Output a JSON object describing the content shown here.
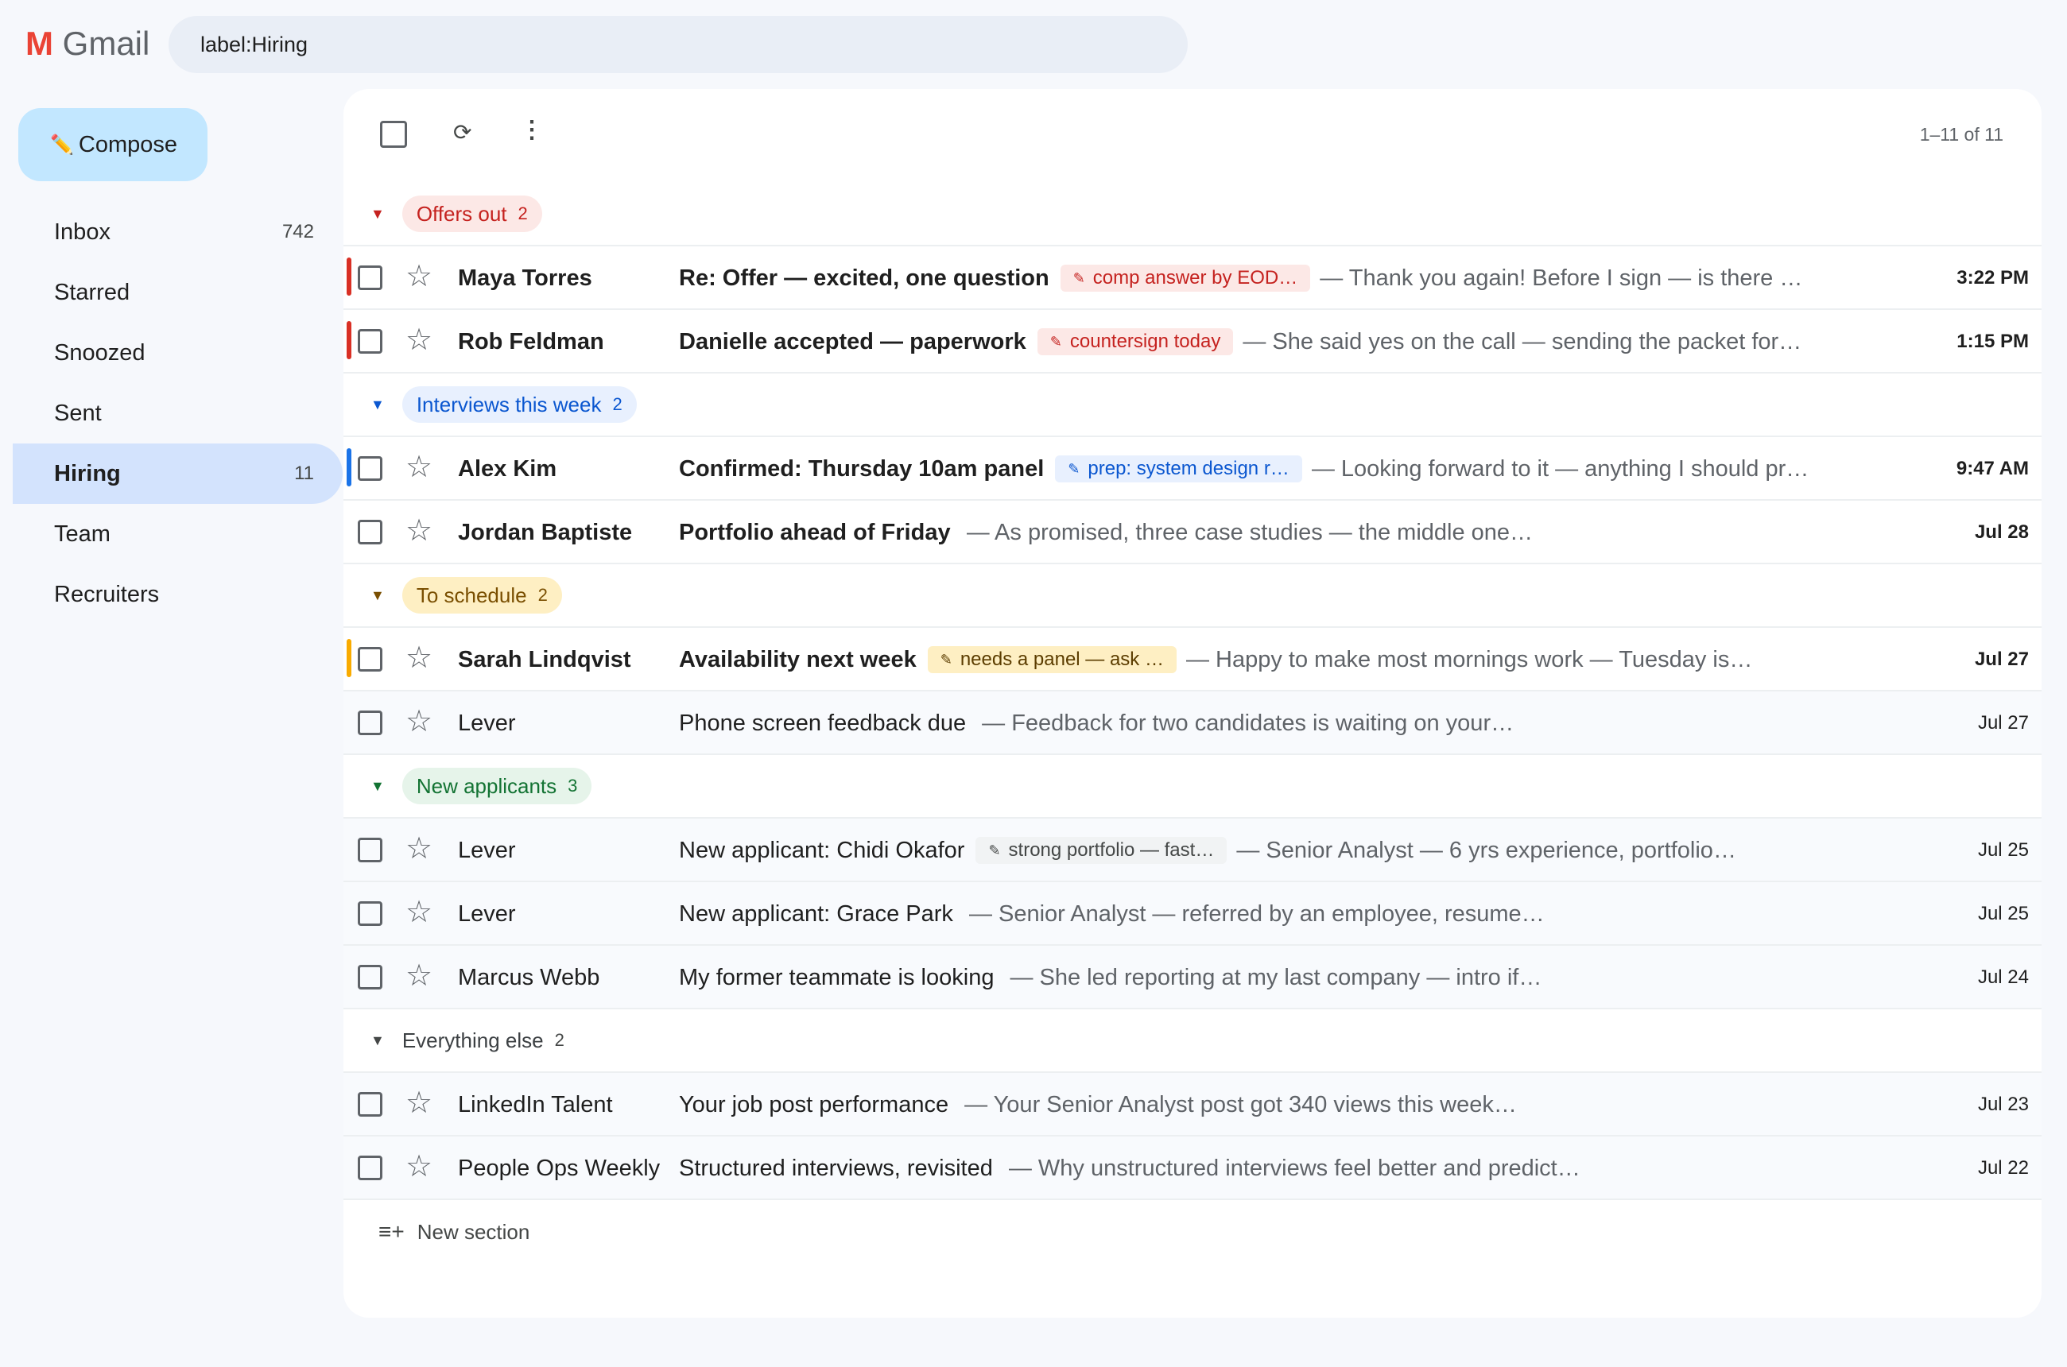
{
  "app": {
    "logo_m": "M",
    "logo_text": "Gmail"
  },
  "search": {
    "query": "label:Hiring"
  },
  "compose": {
    "icon": "✏️",
    "label": "Compose"
  },
  "nav": {
    "items": [
      {
        "label": "Inbox",
        "count": "742"
      },
      {
        "label": "Starred",
        "count": ""
      },
      {
        "label": "Snoozed",
        "count": ""
      },
      {
        "label": "Sent",
        "count": ""
      },
      {
        "label": "Hiring",
        "count": "11"
      },
      {
        "label": "Team",
        "count": ""
      },
      {
        "label": "Recruiters",
        "count": ""
      }
    ]
  },
  "toolbar": {
    "refresh_icon": "⟳",
    "more_icon": "⋮",
    "range": "1–11 of 11"
  },
  "sections": {
    "offers": {
      "label": "Offers out",
      "count": "2",
      "color": "#c5221f",
      "rows": [
        {
          "sender": "Maya Torres",
          "subject": "Re: Offer — excited, one question",
          "note": "comp answer by EOD…",
          "snippet": "— Thank you again! Before I sign — is there any…",
          "date": "3:22 PM"
        },
        {
          "sender": "Rob Feldman",
          "subject": "Danielle accepted — paperwork",
          "note": "countersign today",
          "snippet": "— She said yes on the call — sending the packet for…",
          "date": "1:15 PM"
        }
      ]
    },
    "interviews": {
      "label": "Interviews this week",
      "count": "2",
      "color": "#0b57d0",
      "rows": [
        {
          "sender": "Alex Kim",
          "subject": "Confirmed: Thursday 10am panel",
          "note": "prep: system design r…",
          "snippet": "— Looking forward to it — anything I should prepare…",
          "date": "9:47 AM"
        },
        {
          "sender": "Jordan Baptiste",
          "subject": "Portfolio ahead of Friday",
          "snippet": "— As promised, three case studies — the middle one…",
          "date": "Jul 28"
        }
      ]
    },
    "schedule": {
      "label": "To schedule",
      "count": "2",
      "color": "#f9ab00",
      "rows": [
        {
          "sender": "Sarah Lindqvist",
          "subject": "Availability next week",
          "note": "needs a panel — ask …",
          "snippet": "— Happy to make most mornings work — Tuesday is…",
          "date": "Jul 27"
        },
        {
          "sender": "Lever",
          "subject": "Phone screen feedback due",
          "snippet": "— Feedback for two candidates is waiting on your…",
          "date": "Jul 27"
        }
      ]
    },
    "new_applicants": {
      "label": "New applicants",
      "count": "3",
      "color": "#137333",
      "rows": [
        {
          "sender": "Lever",
          "subject": "New applicant: Chidi Okafor",
          "note": "strong portfolio — fast…",
          "snippet": "— Senior Analyst — 6 yrs experience, portfolio…",
          "date": "Jul 25"
        },
        {
          "sender": "Lever",
          "subject": "New applicant: Grace Park",
          "snippet": "— Senior Analyst — referred by an employee, resume…",
          "date": "Jul 25"
        },
        {
          "sender": "Marcus Webb",
          "subject": "My former teammate is looking",
          "snippet": "— She led reporting at my last company — intro if…",
          "date": "Jul 24"
        }
      ]
    },
    "else": {
      "label": "Everything else",
      "count": "2",
      "rows": [
        {
          "sender": "LinkedIn Talent",
          "subject": "Your job post performance",
          "snippet": "— Your Senior Analyst post got 340 views this week…",
          "date": "Jul 23"
        },
        {
          "sender": "People Ops Weekly",
          "subject": "Structured interviews, revisited",
          "snippet": "— Why unstructured interviews feel better and predict…",
          "date": "Jul 22"
        }
      ]
    }
  },
  "new_section": {
    "icon": "≡+",
    "label": "New section"
  }
}
